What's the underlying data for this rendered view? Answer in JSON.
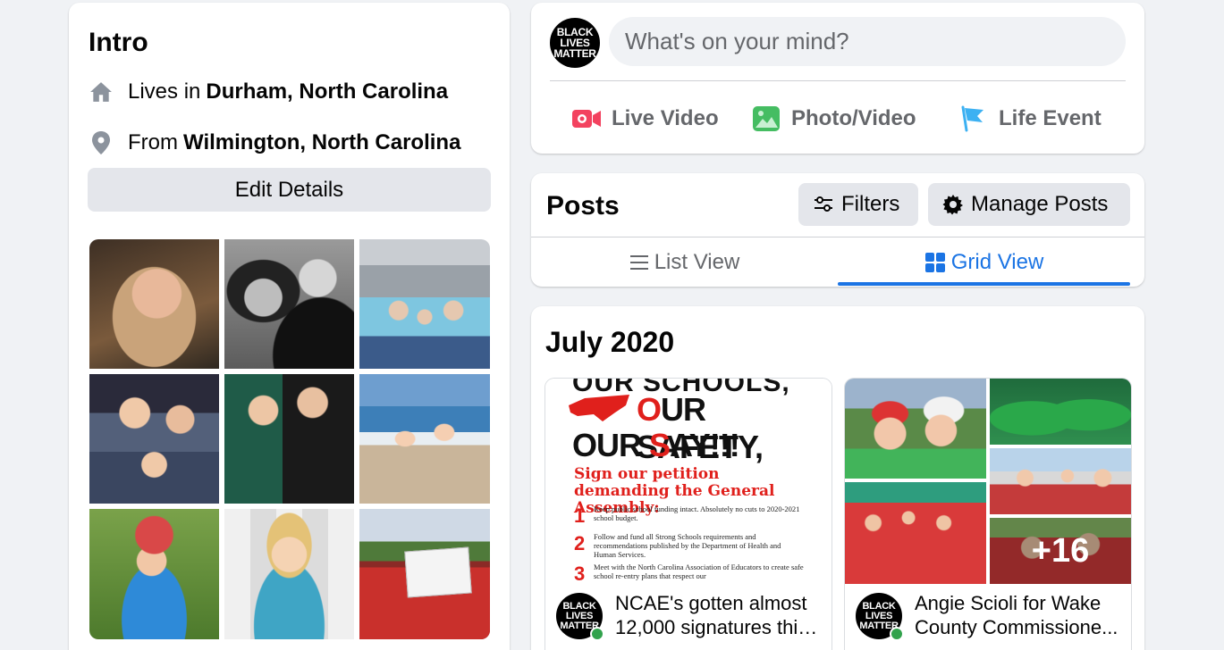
{
  "intro": {
    "title": "Intro",
    "lives_prefix": "Lives in",
    "lives_place": "Durham, North Carolina",
    "from_prefix": "From",
    "from_place": "Wilmington, North Carolina",
    "edit_label": "Edit Details"
  },
  "composer": {
    "avatar_text": [
      "BLACK",
      "LIVES",
      "MATTER"
    ],
    "placeholder": "What's on your mind?",
    "actions": [
      {
        "label": "Live Video",
        "icon": "live-video-icon",
        "color": "#f3425f"
      },
      {
        "label": "Photo/Video",
        "icon": "photo-icon",
        "color": "#45bd62"
      },
      {
        "label": "Life Event",
        "icon": "flag-icon",
        "color": "#3db1f2"
      }
    ]
  },
  "posts": {
    "title": "Posts",
    "filters_label": "Filters",
    "manage_label": "Manage Posts",
    "list_view_label": "List View",
    "grid_view_label": "Grid View"
  },
  "grid": {
    "month": "July 2020",
    "tiles": [
      {
        "flyer": {
          "top": "OUR SCHOOLS,",
          "line1a": "O",
          "line1b": "UR SAFETY,",
          "line2a": "OUR ",
          "line2b": "S",
          "line2c": "AY!!!",
          "sub": "Sign our petition demanding the General Assembly:",
          "items": [
            {
              "n": "1",
              "t": "Keep public school funding intact. Absolutely no cuts to 2020-2021 school budget."
            },
            {
              "n": "2",
              "t": "Follow and fund all Strong Schools requirements and recommendations published by the Department of Health and Human Services."
            },
            {
              "n": "3",
              "t": "Meet with the North Carolina Association of Educators to create safe school re-entry plans that respect our"
            }
          ]
        },
        "line1": "NCAE's gotten almost",
        "line2": "12,000 signatures this..."
      },
      {
        "more_count": "+16",
        "line1": "Angie Scioli for Wake",
        "line2": "County Commissione..."
      }
    ]
  },
  "colors": {
    "accent": "#1b74e4",
    "button_bg": "#e4e6eb",
    "online": "#31a24c"
  }
}
